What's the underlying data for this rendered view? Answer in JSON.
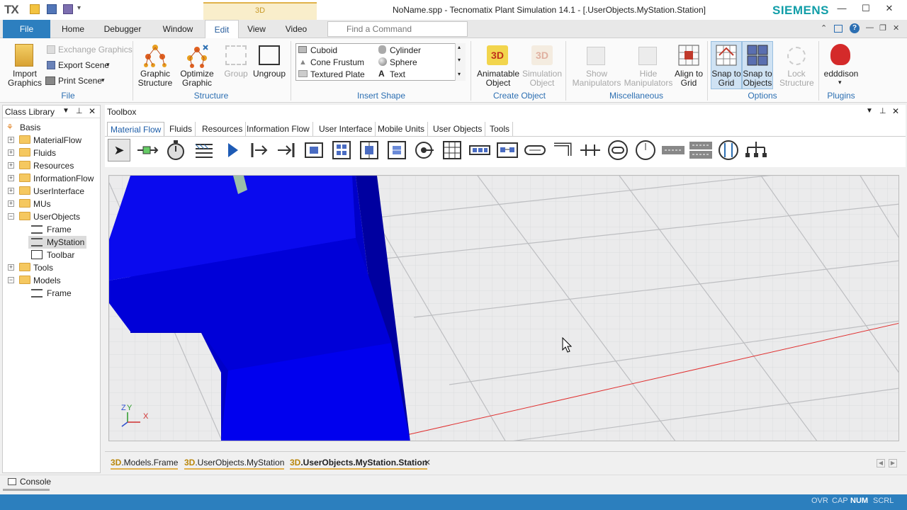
{
  "titlebar": {
    "logo": "TX",
    "context_tab": "3D",
    "window_title": "NoName.spp - Tecnomatix Plant Simulation 14.1 - [.UserObjects.MyStation.Station]",
    "brand": "SIEMENS",
    "brand_color": "#119ea8"
  },
  "menu": {
    "file": "File",
    "home": "Home",
    "debugger": "Debugger",
    "window": "Window",
    "edit": "Edit",
    "view": "View",
    "video": "Video",
    "find_placeholder": "Find a Command"
  },
  "ribbon": {
    "file_group": {
      "label": "File",
      "import": "Import Graphics",
      "exchange": "Exchange Graphics",
      "export": "Export Scene",
      "print": "Print Scene"
    },
    "structure_group": {
      "label": "Structure",
      "graphic_structure": "Graphic Structure",
      "optimize": "Optimize Graphic",
      "group": "Group",
      "ungroup": "Ungroup"
    },
    "insert_shape": {
      "label": "Insert Shape",
      "items": [
        "Cuboid",
        "Cylinder",
        "Cone Frustum",
        "Sphere",
        "Textured Plate",
        "Text"
      ]
    },
    "create_object": {
      "label": "Create Object",
      "animatable": "Animatable Object",
      "simulation": "Simulation Object"
    },
    "misc": {
      "label": "Miscellaneous",
      "show": "Show Manipulators",
      "hide": "Hide Manipulators",
      "align": "Align to Grid"
    },
    "options": {
      "label": "Options",
      "snap_grid": "Snap to Grid",
      "snap_objects": "Snap to Objects",
      "lock": "Lock Structure"
    },
    "plugins": {
      "label": "Plugins",
      "edddison": "edddison"
    }
  },
  "class_library": {
    "title": "Class Library",
    "items": [
      "Basis",
      "MaterialFlow",
      "Fluids",
      "Resources",
      "InformationFlow",
      "UserInterface",
      "MUs",
      "UserObjects",
      "Frame",
      "MyStation",
      "Toolbar",
      "Tools",
      "Models",
      "Frame"
    ]
  },
  "toolbox": {
    "title": "Toolbox",
    "tabs": [
      "Material Flow",
      "Fluids",
      "Resources",
      "Information Flow",
      "User Interface",
      "Mobile Units",
      "User Objects",
      "Tools"
    ]
  },
  "doc_tabs": [
    {
      "prefix": "3D",
      "label": ".Models.Frame"
    },
    {
      "prefix": "3D",
      "label": ".UserObjects.MyStation"
    },
    {
      "prefix": "3D",
      "label": ".UserObjects.MyStation.Station"
    }
  ],
  "console": {
    "label": "Console"
  },
  "status": {
    "ovr": "OVR",
    "cap": "CAP",
    "num": "NUM",
    "scrl": "SCRL"
  },
  "axis": {
    "z": "Z",
    "y": "Y",
    "x": "X"
  }
}
